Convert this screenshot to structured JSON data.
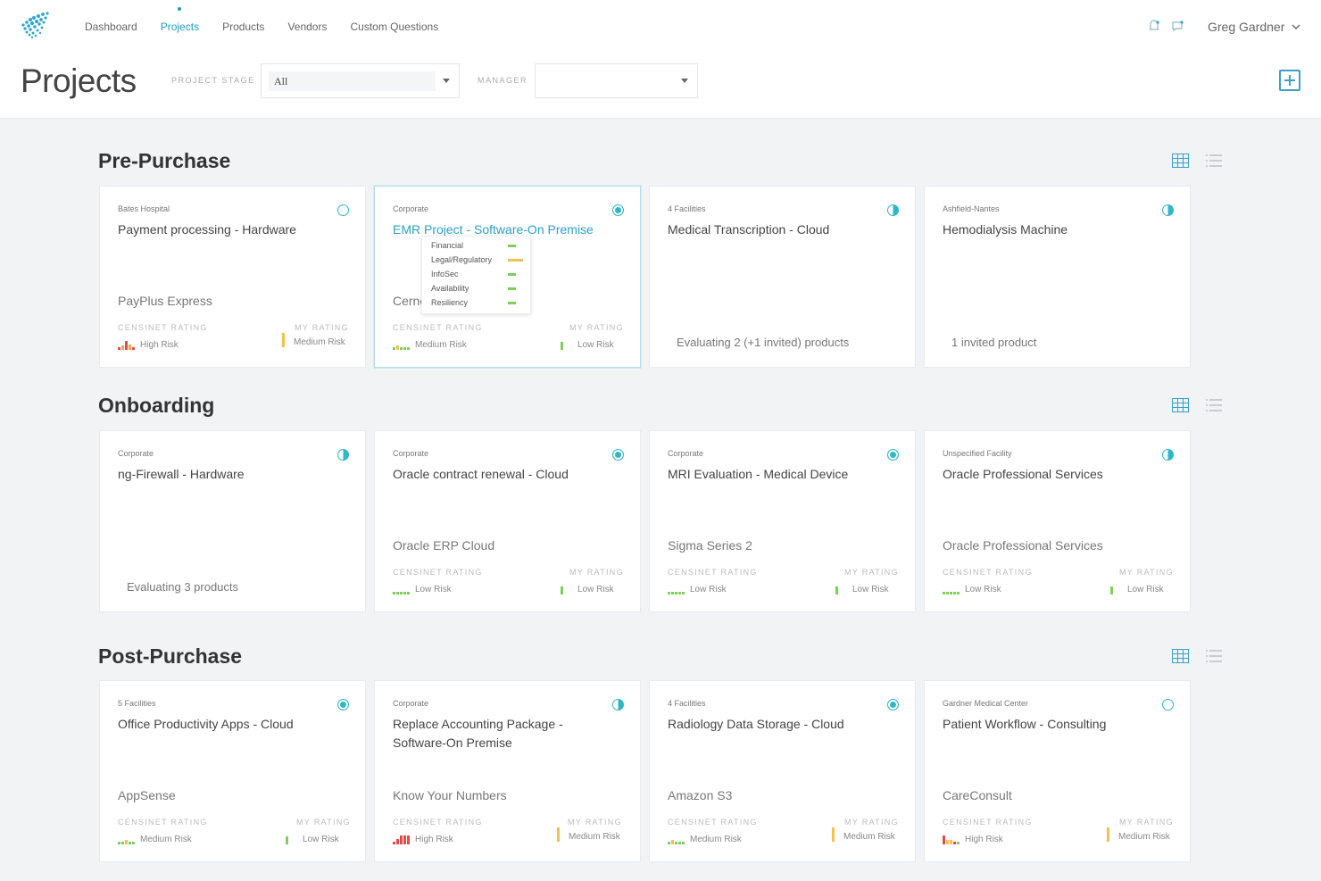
{
  "nav": {
    "items": [
      "Dashboard",
      "Projects",
      "Products",
      "Vendors",
      "Custom Questions"
    ],
    "active": "Projects"
  },
  "user": {
    "name": "Greg Gardner"
  },
  "page": {
    "title": "Projects"
  },
  "filters": {
    "stage_label": "PROJECT STAGE",
    "stage_value": "All",
    "manager_label": "MANAGER",
    "manager_value": ""
  },
  "colors": {
    "accent": "#1c9bbf",
    "low_risk": "#7dcf5a",
    "medium_risk": "#f2c14e",
    "high_risk": "#e24b4b"
  },
  "labels": {
    "censinet_rating": "CENSINET RATING",
    "my_rating": "MY RATING"
  },
  "sections": [
    {
      "title": "Pre-Purchase",
      "cards": [
        {
          "facility": "Bates Hospital",
          "title": "Payment processing - Hardware",
          "status": "empty",
          "product": "PayPlus Express",
          "censinet": "High Risk",
          "mine": "Medium Risk"
        },
        {
          "facility": "Corporate",
          "title": "EMR Project - Software-On Premise",
          "status": "full",
          "product": "Cerne",
          "censinet": "Medium Risk",
          "mine": "Low Risk",
          "highlight": true
        },
        {
          "facility": "4 Facilities",
          "title": "Medical Transcription - Cloud",
          "status": "half",
          "evaluating": "Evaluating 2 (+1 invited) products"
        },
        {
          "facility": "Ashfield-Nantes",
          "title": "Hemodialysis Machine",
          "status": "half",
          "evaluating": "1 invited product"
        }
      ]
    },
    {
      "title": "Onboarding",
      "cards": [
        {
          "facility": "Corporate",
          "title": "ng-Firewall - Hardware",
          "status": "half",
          "evaluating": "Evaluating 3 products"
        },
        {
          "facility": "Corporate",
          "title": "Oracle contract renewal - Cloud",
          "status": "full",
          "product": "Oracle ERP Cloud",
          "censinet": "Low Risk",
          "mine": "Low Risk"
        },
        {
          "facility": "Corporate",
          "title": "MRI Evaluation - Medical Device",
          "status": "full",
          "product": "Sigma Series 2",
          "censinet": "Low Risk",
          "mine": "Low Risk"
        },
        {
          "facility": "Unspecified Facility",
          "title": "Oracle Professional Services",
          "status": "half",
          "product": "Oracle Professional Services",
          "censinet": "Low Risk",
          "mine": "Low Risk"
        }
      ]
    },
    {
      "title": "Post-Purchase",
      "cards": [
        {
          "facility": "5 Facilities",
          "title": "Office Productivity Apps - Cloud",
          "status": "full",
          "product": "AppSense",
          "censinet": "Medium Risk",
          "mine": "Low Risk"
        },
        {
          "facility": "Corporate",
          "title": "Replace Accounting Package - Software-On Premise",
          "status": "half",
          "product": "Know Your Numbers",
          "censinet": "High Risk",
          "mine": "Medium Risk"
        },
        {
          "facility": "4 Facilities",
          "title": "Radiology Data Storage - Cloud",
          "status": "full",
          "product": "Amazon S3",
          "censinet": "Medium Risk",
          "mine": "Medium Risk"
        },
        {
          "facility": "Gardner Medical Center",
          "title": "Patient Workflow - Consulting",
          "status": "empty",
          "product": "CareConsult",
          "censinet": "High Risk",
          "mine": "Medium Risk"
        }
      ]
    }
  ],
  "tooltip": {
    "rows": [
      {
        "label": "Financial",
        "level": "low"
      },
      {
        "label": "Legal/Regulatory",
        "level": "medium"
      },
      {
        "label": "InfoSec",
        "level": "low"
      },
      {
        "label": "Availability",
        "level": "low"
      },
      {
        "label": "Resiliency",
        "level": "low"
      }
    ]
  }
}
